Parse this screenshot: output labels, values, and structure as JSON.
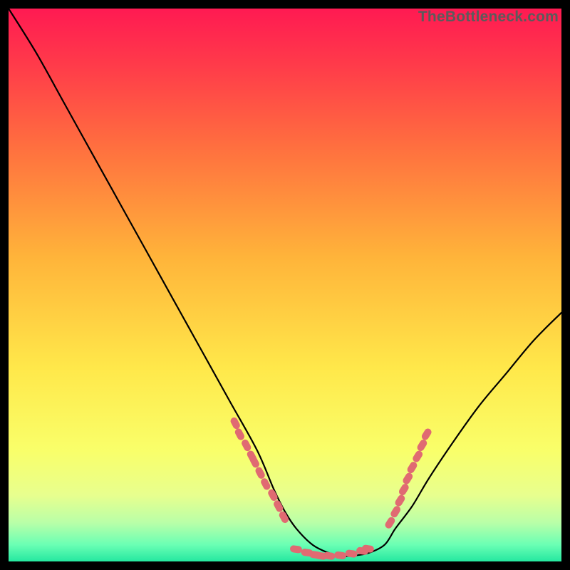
{
  "watermark": "TheBottleneck.com",
  "colors": {
    "dot": "#e06a72",
    "curve": "#000000"
  },
  "chart_data": {
    "type": "line",
    "title": "",
    "xlabel": "",
    "ylabel": "",
    "ylim": [
      0,
      100
    ],
    "x": [
      0.0,
      0.05,
      0.1,
      0.15,
      0.2,
      0.25,
      0.3,
      0.35,
      0.4,
      0.45,
      0.48,
      0.5,
      0.52,
      0.55,
      0.58,
      0.6,
      0.62,
      0.65,
      0.68,
      0.7,
      0.73,
      0.76,
      0.8,
      0.85,
      0.9,
      0.95,
      1.0
    ],
    "values": [
      100,
      92,
      83,
      74,
      65,
      56,
      47,
      38,
      29,
      20,
      13,
      9,
      6,
      3,
      1.5,
      1,
      1,
      1.5,
      3,
      6,
      10,
      15,
      21,
      28,
      34,
      40,
      45
    ],
    "series": [
      {
        "name": "left-cluster",
        "kind": "dots",
        "x": [
          0.41,
          0.418,
          0.43,
          0.44,
          0.445,
          0.455,
          0.465,
          0.478,
          0.488,
          0.498
        ],
        "values": [
          25,
          23,
          21,
          19,
          18,
          16,
          14,
          12,
          10,
          8
        ]
      },
      {
        "name": "bottom-cluster",
        "kind": "dots",
        "x": [
          0.52,
          0.54,
          0.555,
          0.565,
          0.58,
          0.6,
          0.62,
          0.64,
          0.65
        ],
        "values": [
          2.2,
          1.6,
          1.2,
          1.0,
          1.0,
          1.1,
          1.4,
          1.9,
          2.3
        ]
      },
      {
        "name": "right-cluster",
        "kind": "dots",
        "x": [
          0.69,
          0.7,
          0.708,
          0.715,
          0.722,
          0.73,
          0.74,
          0.748,
          0.756
        ],
        "values": [
          7,
          9,
          11,
          13,
          15,
          17,
          19,
          21,
          23
        ]
      }
    ]
  }
}
